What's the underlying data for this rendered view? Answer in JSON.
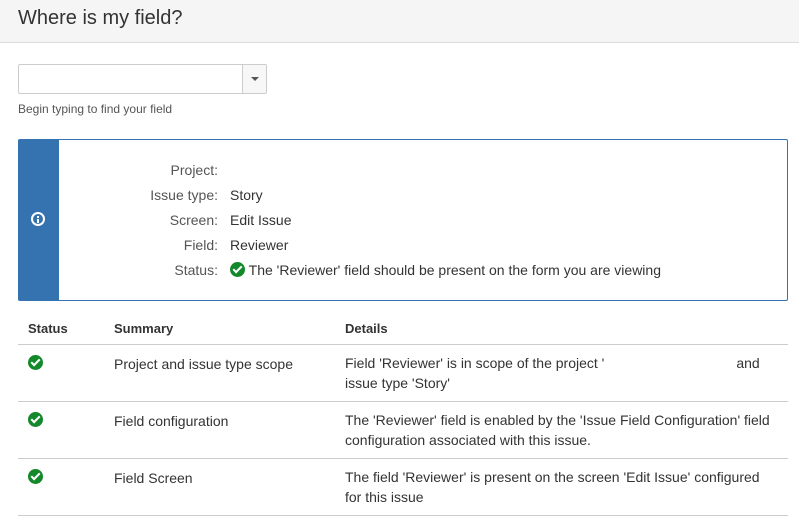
{
  "header": {
    "title": "Where is my field?"
  },
  "picker": {
    "value": "",
    "placeholder": "",
    "hint": "Begin typing to find your field"
  },
  "info": {
    "icon": "info-icon",
    "rows": [
      {
        "label": "Project:",
        "value": ""
      },
      {
        "label": "Issue type:",
        "value": "Story"
      },
      {
        "label": "Screen:",
        "value": "Edit Issue"
      },
      {
        "label": "Field:",
        "value": "Reviewer"
      },
      {
        "label": "Status:",
        "value": "The 'Reviewer' field should be present on the form you are viewing"
      }
    ]
  },
  "table": {
    "headers": {
      "status": "Status",
      "summary": "Summary",
      "details": "Details"
    },
    "rows": [
      {
        "summary": "Project and issue type scope",
        "details_a": "Field 'Reviewer' is in scope of the project '",
        "details_b": "and",
        "details_c": "issue type 'Story'"
      },
      {
        "summary": "Field configuration",
        "details": "The 'Reviewer' field is enabled by the 'Issue Field Configuration' field configuration associated with this issue."
      },
      {
        "summary": "Field Screen",
        "details": "The field 'Reviewer' is present on the screen 'Edit Issue' configured for this issue"
      }
    ]
  },
  "colors": {
    "accent": "#3572b0",
    "success": "#14892c"
  }
}
